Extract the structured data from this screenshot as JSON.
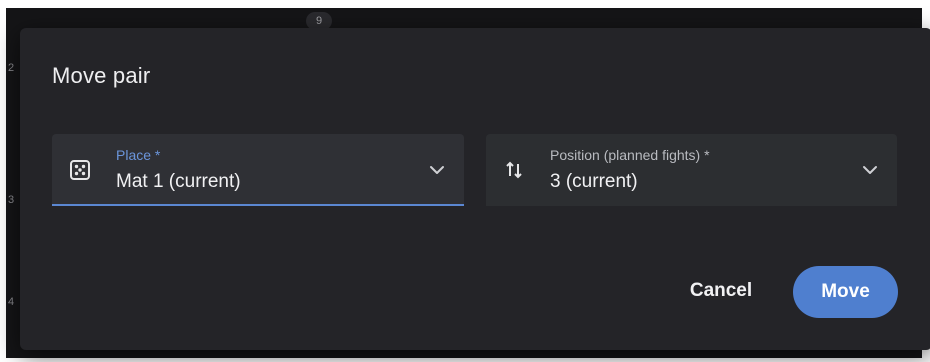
{
  "background": {
    "markers": [
      "9",
      "2",
      "3",
      "4"
    ]
  },
  "dialog": {
    "title": "Move pair",
    "place_field": {
      "label": "Place *",
      "value": "Mat 1 (current)",
      "icon": "dice-icon"
    },
    "position_field": {
      "label": "Position (planned fights) *",
      "value": "3 (current)",
      "icon": "swap-vertical-icon"
    },
    "actions": {
      "cancel_label": "Cancel",
      "move_label": "Move"
    }
  },
  "colors": {
    "accent": "#5b87d2",
    "primary_button": "#4f7fcf",
    "dialog_bg": "#242428",
    "field_bg": "#2f3035"
  }
}
